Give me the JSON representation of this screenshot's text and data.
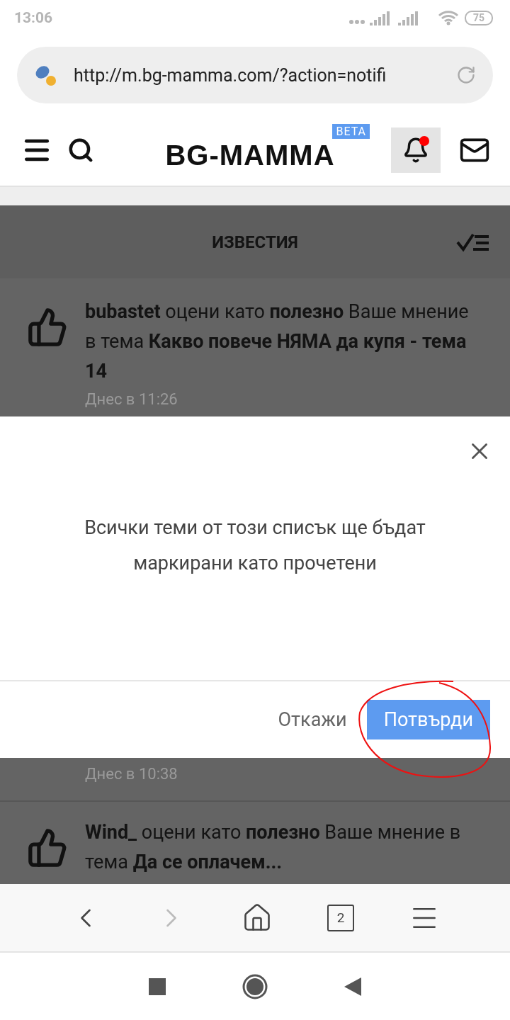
{
  "status_bar": {
    "time": "13:06",
    "battery": "75"
  },
  "url_bar": {
    "url": "http://m.bg-mamma.com/?action=notifi"
  },
  "header": {
    "logo": "BG-MAMMA",
    "badge": "BETA",
    "bell_unread": true,
    "bell_selected": true
  },
  "section": {
    "title": "ИЗВЕСТИЯ"
  },
  "notifications_above": [
    {
      "text": "**bubastet** оцени като **полезно** Ваше мнение в тема **Какво повече НЯМА да купя - тема 14**",
      "time": "Днес в 11:26"
    }
  ],
  "modal": {
    "message": "Всички теми от този списък ще бъдат маркирани като прочетени",
    "cancel": "Откажи",
    "confirm": "Потвърди",
    "annotated": true
  },
  "notifications_below": [
    {
      "time": "Днес в 10:38"
    },
    {
      "text": "**Wind_** оцени като **полезно** Ваше мнение в тема **Да се оплачем...**"
    }
  ],
  "browser_nav": {
    "tabs_count": "2",
    "forward_disabled": true
  }
}
